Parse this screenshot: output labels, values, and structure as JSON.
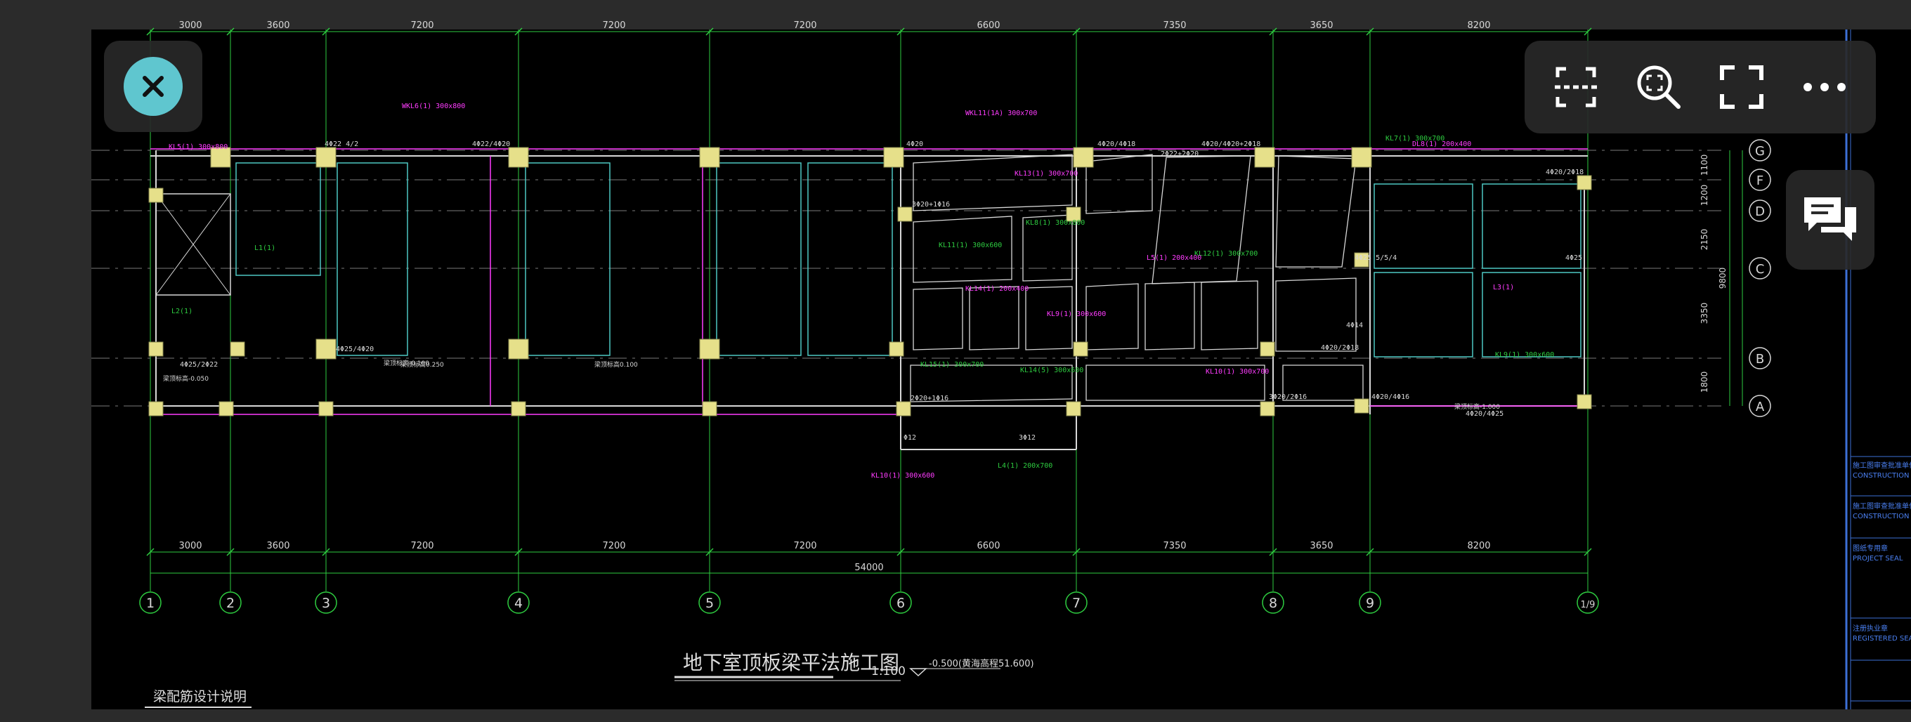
{
  "drawing": {
    "title": "地下室顶板梁平法施工图",
    "scale": "1:100",
    "elevation_note": "-0.500(黄海高程51.600)",
    "design_note": "梁配筋设计说明",
    "total_dimension": "54000",
    "spans_top": [
      "3000",
      "3600",
      "7200",
      "7200",
      "7200",
      "6600",
      "7350",
      "3650",
      "8200"
    ],
    "spans_bottom": [
      "3000",
      "3600",
      "7200",
      "7200",
      "7200",
      "6600",
      "7350",
      "3650",
      "8200"
    ],
    "axes_numbers": [
      "1",
      "2",
      "3",
      "4",
      "5",
      "6",
      "7",
      "8",
      "9",
      "1/9"
    ],
    "axes_letters": [
      "G",
      "F",
      "D",
      "C",
      "B",
      "A"
    ],
    "right_dims": [
      "1100",
      "1200",
      "2150",
      "3350",
      "1800"
    ],
    "right_total": "9800"
  },
  "beams": [
    "WKL6(1) 300x800",
    "KL5(1) 300x800",
    "WKL11(1A) 300x700",
    "KL13(1) 300x700",
    "KL11(1) 300x600",
    "KL14(1) 200x400",
    "KL8(1) 300x800",
    "KL9(1) 300x600",
    "KL12(1) 300x700",
    "L5(1) 200x400",
    "L4(1) 200x700",
    "KL10(1) 300x700",
    "KL15(1) 300x700",
    "KL14(5) 300x600",
    "KL10(1) 300x600",
    "KL7(1) 300x700",
    "DL8(1) 200x400",
    "L3(1)",
    "L2(1)",
    "L1(1)",
    "KL9(1) 300x600"
  ],
  "rebar_notes": [
    "4Φ22 4/2",
    "4Φ22/4Φ20",
    "4Φ20",
    "4Φ20/4Φ18",
    "4Φ20/4Φ20+2Φ18",
    "4Φ20/2Φ18",
    "3Φ20+1Φ16",
    "4Φ25/4Φ20",
    "4Φ25/2Φ22",
    "4Φ20/2Φ18",
    "2Φ20+1Φ16",
    "3Φ20/2Φ16",
    "4Φ20/4Φ25",
    "4Φ20/4Φ16",
    "4Φ25 5/5/4",
    "4Φ25",
    "4Φ14",
    "3Φ12",
    "Φ12",
    "2Φ22+2Φ20"
  ],
  "elevation_tags": [
    "梁顶标高-0.050",
    "梁顶标高-0.100",
    "梁顶标高-1.000",
    "梁顶标高0.250",
    "梁顶标高0.100"
  ],
  "right_strip": [
    {
      "cn": "施工图审查批准单位",
      "en": "CONSTRUCTION DR"
    },
    {
      "cn": "施工图审查批准单位",
      "en": "CONSTRUCTION DRAW"
    },
    {
      "cn": "图纸专用章",
      "en": "PROJECT SEAL"
    },
    {
      "cn": "注册执业章",
      "en": "REGISTERED SEAL"
    }
  ],
  "ui": {
    "close": "close",
    "tools": [
      "crop-icon",
      "zoom-fit-icon",
      "fullscreen-icon",
      "more-icon"
    ],
    "comment": "comment-icon"
  },
  "colors": {
    "background": "#000000",
    "grid": "#2ecc40",
    "beam_label": "#ff3cff",
    "column": "#e6e08a",
    "outline": "#d8d8d8",
    "accent": "#5fc6cf"
  }
}
